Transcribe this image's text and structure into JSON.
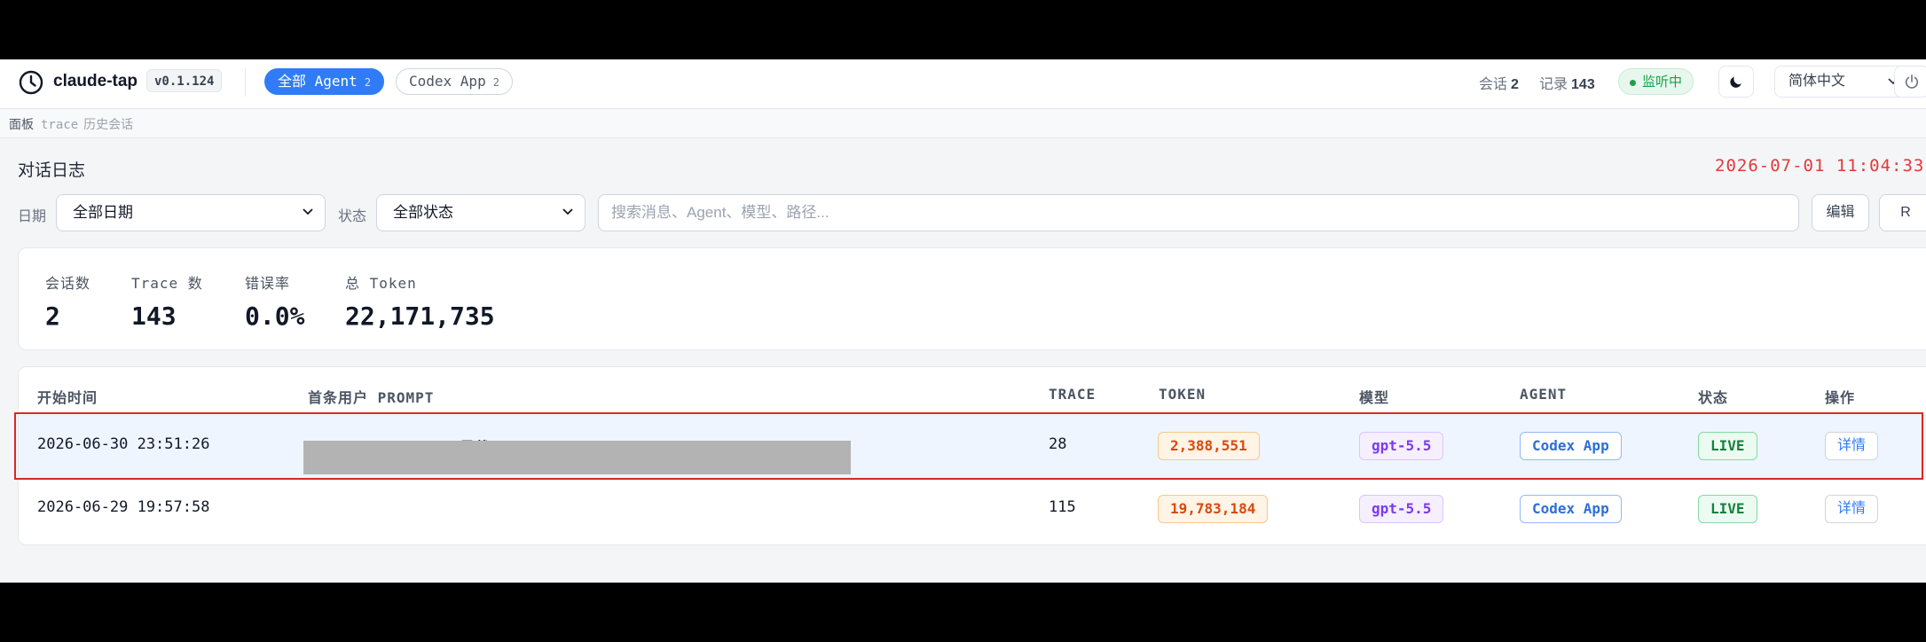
{
  "header": {
    "app_name": "claude-tap",
    "version": "v0.1.124",
    "tabs": [
      {
        "label": "全部 Agent",
        "count": "2"
      },
      {
        "label": "Codex App",
        "count": "2"
      }
    ],
    "sessions_label": "会话",
    "sessions_value": "2",
    "records_label": "记录",
    "records_value": "143",
    "status": "监听中",
    "language": "简体中文"
  },
  "breadcrumb": [
    "面板",
    "trace",
    "历史会话"
  ],
  "page": {
    "title": "对话日志",
    "datetime": "2026-07-01 11:04:33"
  },
  "filters": {
    "date_label": "日期",
    "date_value": "全部日期",
    "status_label": "状态",
    "status_value": "全部状态",
    "search_placeholder": "搜索消息、Agent、模型、路径...",
    "edit_label": "编辑",
    "refresh_label": "R"
  },
  "summary": [
    {
      "label": "会话数",
      "value": "2"
    },
    {
      "label": "Trace 数",
      "value": "143"
    },
    {
      "label": "错误率",
      "value": "0.0%"
    },
    {
      "label": "总 Token",
      "value": "22,171,735"
    }
  ],
  "table": {
    "columns": [
      "开始时间",
      "首条用户 PROMPT",
      "TRACE",
      "TOKEN",
      "模型",
      "AGENT",
      "状态",
      "操作"
    ],
    "rows": [
      {
        "start": "2026-06-30 23:51:26",
        "prompt": "Automation: codex用量截图-2359 Automation ID: codex-2359 Automat...",
        "trace": "28",
        "token": "2,388,551",
        "model": "gpt-5.5",
        "agent": "Codex App",
        "status": "LIVE",
        "action": "详情"
      },
      {
        "start": "2026-06-29 19:57:58",
        "prompt": "",
        "trace": "115",
        "token": "19,783,184",
        "model": "gpt-5.5",
        "agent": "Codex App",
        "status": "LIVE",
        "action": "详情"
      }
    ]
  }
}
